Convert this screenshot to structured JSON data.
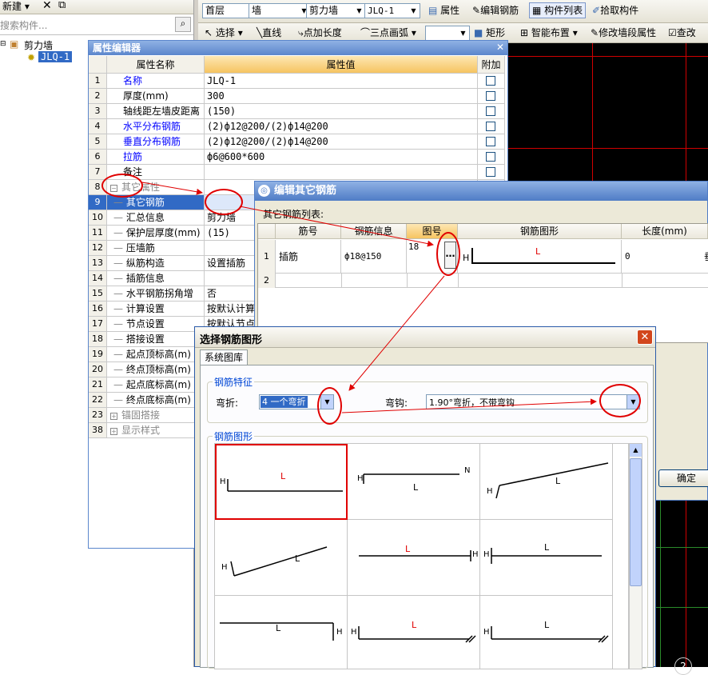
{
  "top_toolbar": {
    "new_label": "新建",
    "floor": "首层",
    "category": "墙",
    "subcategory": "剪力墙",
    "component": "JLQ-1",
    "btn_property": "属性",
    "btn_edit_rebar": "编辑钢筋",
    "btn_component_list": "构件列表",
    "btn_pick": "拾取构件",
    "btn_select": "选择",
    "btn_line": "直线",
    "btn_point_length": "点加长度",
    "btn_arc": "三点画弧",
    "btn_rect": "矩形",
    "btn_smart": "智能布置",
    "btn_modify_segment": "修改墙段属性",
    "btn_check": "查改"
  },
  "left_panel": {
    "search_placeholder": "搜索构件...",
    "tree_root": "剪力墙",
    "tree_child": "JLQ-1"
  },
  "property_editor": {
    "title": "属性编辑器",
    "col_name": "属性名称",
    "col_value": "属性值",
    "col_add": "附加",
    "rows": [
      {
        "num": "1",
        "name": "名称",
        "value": "JLQ-1"
      },
      {
        "num": "2",
        "name": "厚度(mm)",
        "value": "300"
      },
      {
        "num": "3",
        "name": "轴线距左墙皮距离",
        "value": "(150)"
      },
      {
        "num": "4",
        "name": "水平分布钢筋",
        "value": "(2)ф12@200/(2)ф14@200"
      },
      {
        "num": "5",
        "name": "垂直分布钢筋",
        "value": "(2)ф12@200/(2)ф14@200"
      },
      {
        "num": "6",
        "name": "拉筋",
        "value": "ф6@600*600"
      },
      {
        "num": "7",
        "name": "备注",
        "value": ""
      },
      {
        "num": "8",
        "name": "其它属性",
        "value": ""
      },
      {
        "num": "9",
        "name": "其它钢筋",
        "value": ""
      },
      {
        "num": "10",
        "name": "汇总信息",
        "value": "剪力墙"
      },
      {
        "num": "11",
        "name": "保护层厚度(mm)",
        "value": "(15)"
      },
      {
        "num": "12",
        "name": "压墙筋",
        "value": ""
      },
      {
        "num": "13",
        "name": "纵筋构造",
        "value": "设置插筋"
      },
      {
        "num": "14",
        "name": "插筋信息",
        "value": ""
      },
      {
        "num": "15",
        "name": "水平钢筋拐角增",
        "value": "否"
      },
      {
        "num": "16",
        "name": "计算设置",
        "value": "按默认计算"
      },
      {
        "num": "17",
        "name": "节点设置",
        "value": "按默认节点"
      },
      {
        "num": "18",
        "name": "搭接设置",
        "value": ""
      },
      {
        "num": "19",
        "name": "起点顶标高(m)",
        "value": ""
      },
      {
        "num": "20",
        "name": "终点顶标高(m)",
        "value": ""
      },
      {
        "num": "21",
        "name": "起点底标高(m)",
        "value": ""
      },
      {
        "num": "22",
        "name": "终点底标高(m)",
        "value": ""
      },
      {
        "num": "23",
        "name": "锚固搭接",
        "value": ""
      },
      {
        "num": "38",
        "name": "显示样式",
        "value": ""
      }
    ]
  },
  "edit_rebar_dialog": {
    "title": "编辑其它钢筋",
    "list_label": "其它钢筋列表:",
    "col_bar_no": "筋号",
    "col_bar_info": "钢筋信息",
    "col_shape_no": "图号",
    "col_shape": "钢筋图形",
    "col_length": "长度(mm)",
    "row1": {
      "num": "1",
      "bar_no": "插筋",
      "info": "ф18@150",
      "shape_no": "18",
      "shape_label": "L",
      "shape_h": "H",
      "length": "0",
      "extra": "垂"
    },
    "row2_num": "2",
    "ok_label": "确定"
  },
  "shape_dialog": {
    "title": "选择钢筋图形",
    "tab": "系统图库",
    "group_feature": "钢筋特征",
    "bend_label": "弯折:",
    "bend_value": "4 一个弯折",
    "hook_label": "弯钩:",
    "hook_value": "1.90°弯折，不带弯钩",
    "group_shape": "钢筋图形",
    "shape_texts": {
      "h": "H",
      "l": "L",
      "n": "N"
    }
  },
  "canvas": {
    "badge": "2"
  },
  "colors": {
    "accent_red": "#e00000",
    "title_blue": "#4f7cc6",
    "canvas_bg": "#000000",
    "grid_red": "#d00000",
    "grid_green": "#2a8a2a"
  }
}
